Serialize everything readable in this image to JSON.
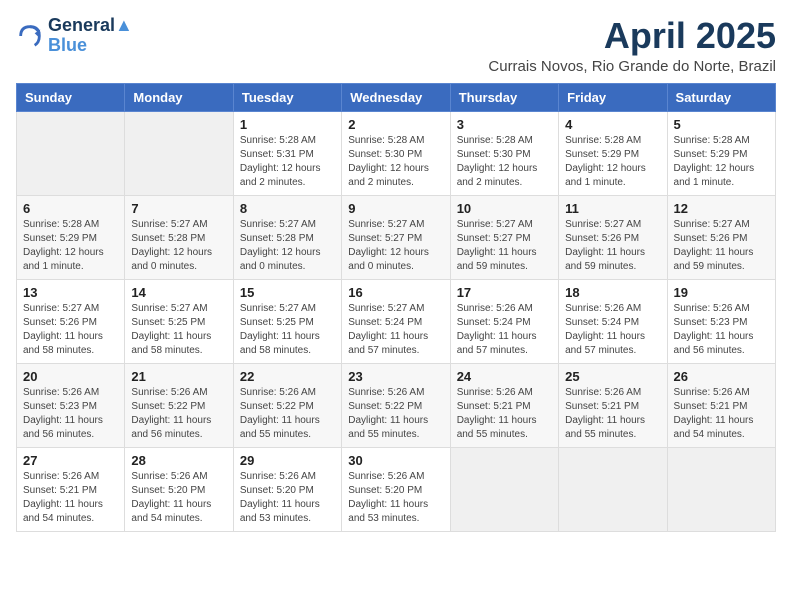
{
  "header": {
    "logo_line1": "General",
    "logo_line2": "Blue",
    "month_year": "April 2025",
    "location": "Currais Novos, Rio Grande do Norte, Brazil"
  },
  "weekdays": [
    "Sunday",
    "Monday",
    "Tuesday",
    "Wednesday",
    "Thursday",
    "Friday",
    "Saturday"
  ],
  "weeks": [
    [
      {
        "day": "",
        "info": ""
      },
      {
        "day": "",
        "info": ""
      },
      {
        "day": "1",
        "info": "Sunrise: 5:28 AM\nSunset: 5:31 PM\nDaylight: 12 hours\nand 2 minutes."
      },
      {
        "day": "2",
        "info": "Sunrise: 5:28 AM\nSunset: 5:30 PM\nDaylight: 12 hours\nand 2 minutes."
      },
      {
        "day": "3",
        "info": "Sunrise: 5:28 AM\nSunset: 5:30 PM\nDaylight: 12 hours\nand 2 minutes."
      },
      {
        "day": "4",
        "info": "Sunrise: 5:28 AM\nSunset: 5:29 PM\nDaylight: 12 hours\nand 1 minute."
      },
      {
        "day": "5",
        "info": "Sunrise: 5:28 AM\nSunset: 5:29 PM\nDaylight: 12 hours\nand 1 minute."
      }
    ],
    [
      {
        "day": "6",
        "info": "Sunrise: 5:28 AM\nSunset: 5:29 PM\nDaylight: 12 hours\nand 1 minute."
      },
      {
        "day": "7",
        "info": "Sunrise: 5:27 AM\nSunset: 5:28 PM\nDaylight: 12 hours\nand 0 minutes."
      },
      {
        "day": "8",
        "info": "Sunrise: 5:27 AM\nSunset: 5:28 PM\nDaylight: 12 hours\nand 0 minutes."
      },
      {
        "day": "9",
        "info": "Sunrise: 5:27 AM\nSunset: 5:27 PM\nDaylight: 12 hours\nand 0 minutes."
      },
      {
        "day": "10",
        "info": "Sunrise: 5:27 AM\nSunset: 5:27 PM\nDaylight: 11 hours\nand 59 minutes."
      },
      {
        "day": "11",
        "info": "Sunrise: 5:27 AM\nSunset: 5:26 PM\nDaylight: 11 hours\nand 59 minutes."
      },
      {
        "day": "12",
        "info": "Sunrise: 5:27 AM\nSunset: 5:26 PM\nDaylight: 11 hours\nand 59 minutes."
      }
    ],
    [
      {
        "day": "13",
        "info": "Sunrise: 5:27 AM\nSunset: 5:26 PM\nDaylight: 11 hours\nand 58 minutes."
      },
      {
        "day": "14",
        "info": "Sunrise: 5:27 AM\nSunset: 5:25 PM\nDaylight: 11 hours\nand 58 minutes."
      },
      {
        "day": "15",
        "info": "Sunrise: 5:27 AM\nSunset: 5:25 PM\nDaylight: 11 hours\nand 58 minutes."
      },
      {
        "day": "16",
        "info": "Sunrise: 5:27 AM\nSunset: 5:24 PM\nDaylight: 11 hours\nand 57 minutes."
      },
      {
        "day": "17",
        "info": "Sunrise: 5:26 AM\nSunset: 5:24 PM\nDaylight: 11 hours\nand 57 minutes."
      },
      {
        "day": "18",
        "info": "Sunrise: 5:26 AM\nSunset: 5:24 PM\nDaylight: 11 hours\nand 57 minutes."
      },
      {
        "day": "19",
        "info": "Sunrise: 5:26 AM\nSunset: 5:23 PM\nDaylight: 11 hours\nand 56 minutes."
      }
    ],
    [
      {
        "day": "20",
        "info": "Sunrise: 5:26 AM\nSunset: 5:23 PM\nDaylight: 11 hours\nand 56 minutes."
      },
      {
        "day": "21",
        "info": "Sunrise: 5:26 AM\nSunset: 5:22 PM\nDaylight: 11 hours\nand 56 minutes."
      },
      {
        "day": "22",
        "info": "Sunrise: 5:26 AM\nSunset: 5:22 PM\nDaylight: 11 hours\nand 55 minutes."
      },
      {
        "day": "23",
        "info": "Sunrise: 5:26 AM\nSunset: 5:22 PM\nDaylight: 11 hours\nand 55 minutes."
      },
      {
        "day": "24",
        "info": "Sunrise: 5:26 AM\nSunset: 5:21 PM\nDaylight: 11 hours\nand 55 minutes."
      },
      {
        "day": "25",
        "info": "Sunrise: 5:26 AM\nSunset: 5:21 PM\nDaylight: 11 hours\nand 55 minutes."
      },
      {
        "day": "26",
        "info": "Sunrise: 5:26 AM\nSunset: 5:21 PM\nDaylight: 11 hours\nand 54 minutes."
      }
    ],
    [
      {
        "day": "27",
        "info": "Sunrise: 5:26 AM\nSunset: 5:21 PM\nDaylight: 11 hours\nand 54 minutes."
      },
      {
        "day": "28",
        "info": "Sunrise: 5:26 AM\nSunset: 5:20 PM\nDaylight: 11 hours\nand 54 minutes."
      },
      {
        "day": "29",
        "info": "Sunrise: 5:26 AM\nSunset: 5:20 PM\nDaylight: 11 hours\nand 53 minutes."
      },
      {
        "day": "30",
        "info": "Sunrise: 5:26 AM\nSunset: 5:20 PM\nDaylight: 11 hours\nand 53 minutes."
      },
      {
        "day": "",
        "info": ""
      },
      {
        "day": "",
        "info": ""
      },
      {
        "day": "",
        "info": ""
      }
    ]
  ]
}
